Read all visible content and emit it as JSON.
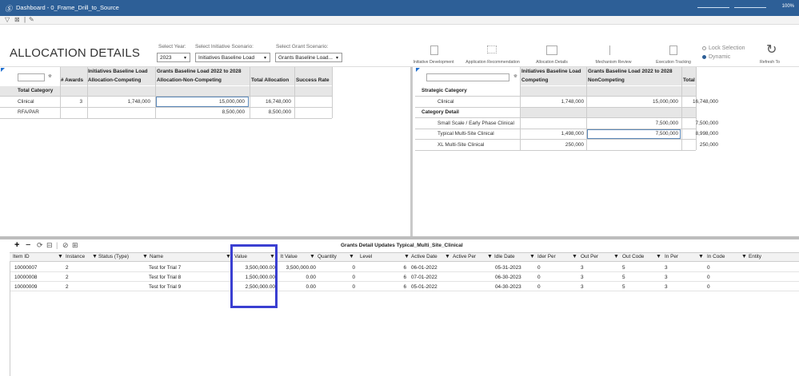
{
  "window": {
    "logo": "Ⓢ",
    "title": "Dashboard - 0_Frame_Drill_to_Source",
    "zoom": "100%"
  },
  "toolbar": {
    "filter_icon": "funnel-icon",
    "icons": [
      "▽",
      "⊠",
      "|",
      "✎"
    ]
  },
  "page": {
    "title": "ALLOCATION DETAILS"
  },
  "filters": {
    "year": {
      "label": "Select Year:",
      "value": "2023"
    },
    "initiative": {
      "label": "Select Initiative Scenario:",
      "value": "Initiatives Baseline Load"
    },
    "grant": {
      "label": "Select Grant Scenario:",
      "value": "Grants Baseline Load..."
    }
  },
  "nav": [
    {
      "label": "Initiative Development",
      "icon": "document-icon"
    },
    {
      "label": "Application Recommendation",
      "icon": "flow-icon"
    },
    {
      "label": "Allocation Details",
      "icon": "chart-icon"
    },
    {
      "label": "Mechanism Review",
      "icon": "list-icon"
    },
    {
      "label": "Execution Tracking",
      "icon": "tracking-icon"
    }
  ],
  "options": {
    "lock": "Lock Selection",
    "dynamic": "Dynamic",
    "refresh": "Refresh To"
  },
  "left_table": {
    "h1": "Initiatives Baseline Load",
    "h2": "Grants Baseline Load 2022 to 2028",
    "cols": [
      "# Awards",
      "Allocation-Competing",
      "Allocation-Non-Competing",
      "Total Allocation",
      "Success Rate"
    ],
    "row_header": "Total Category",
    "rows": [
      {
        "name": "Clinical",
        "awards": "3",
        "competing": "1,748,000",
        "noncompeting": "15,000,000",
        "total": "16,748,000",
        "rate": ""
      },
      {
        "name": "RFA/PAR",
        "awards": "",
        "competing": "",
        "noncompeting": "8,500,000",
        "total": "8,500,000",
        "rate": ""
      }
    ]
  },
  "right_table": {
    "h1": "Initiatives Baseline Load",
    "h2": "Grants Baseline Load 2022 to 2028",
    "cols": [
      "Competing",
      "NonCompeting",
      "Total"
    ],
    "rows": [
      {
        "name": "Strategic Category",
        "type": "header",
        "competing": "",
        "noncompeting": "",
        "total": ""
      },
      {
        "name": "Clinical",
        "type": "data",
        "competing": "1,748,000",
        "noncompeting": "15,000,000",
        "total": "16,748,000"
      },
      {
        "name": "Category Detail",
        "type": "header",
        "competing": "",
        "noncompeting": "",
        "total": ""
      },
      {
        "name": "Small Scale / Early Phase Clinical",
        "type": "data",
        "competing": "",
        "noncompeting": "7,500,000",
        "total": "7,500,000"
      },
      {
        "name": "Typical Multi-Site Clinical",
        "type": "data",
        "competing": "1,498,000",
        "noncompeting": "7,500,000",
        "total": "8,998,000"
      },
      {
        "name": "XL Multi-Site Clinical",
        "type": "data",
        "competing": "250,000",
        "noncompeting": "",
        "total": "250,000"
      }
    ]
  },
  "grid": {
    "title": "Grants Detail Updates  Typical_Multi_Site_Clinical",
    "tools": [
      "+",
      "−",
      "⟳",
      "⊟",
      "|",
      "⊘",
      "⊞"
    ],
    "cols": [
      "Item ID",
      "Instance",
      "Status (Type)",
      "Name",
      "Value",
      "lt Value",
      "Quantity",
      "Level",
      "Active Date",
      "Active Per",
      "Idle Date",
      "Ider Per",
      "Out Per",
      "Out Code",
      "In Per",
      "In Code",
      "Entity"
    ],
    "rows": [
      [
        "10000007",
        "2",
        "",
        "Test for Trial 7",
        "3,500,000.00",
        "3,500,000.00",
        "0",
        "6",
        "06-01-2022",
        "",
        "05-31-2023",
        "0",
        "3",
        "5",
        "3",
        "0",
        ""
      ],
      [
        "10000008",
        "2",
        "",
        "Test for Trial 8",
        "1,500,000.00",
        "0.00",
        "0",
        "6",
        "07-01-2022",
        "",
        "06-30-2023",
        "0",
        "3",
        "5",
        "3",
        "0",
        ""
      ],
      [
        "10000009",
        "2",
        "",
        "Test for Trial 9",
        "2,500,000.00",
        "0.00",
        "0",
        "6",
        "05-01-2022",
        "",
        "04-30-2023",
        "0",
        "3",
        "5",
        "3",
        "0",
        ""
      ]
    ]
  }
}
